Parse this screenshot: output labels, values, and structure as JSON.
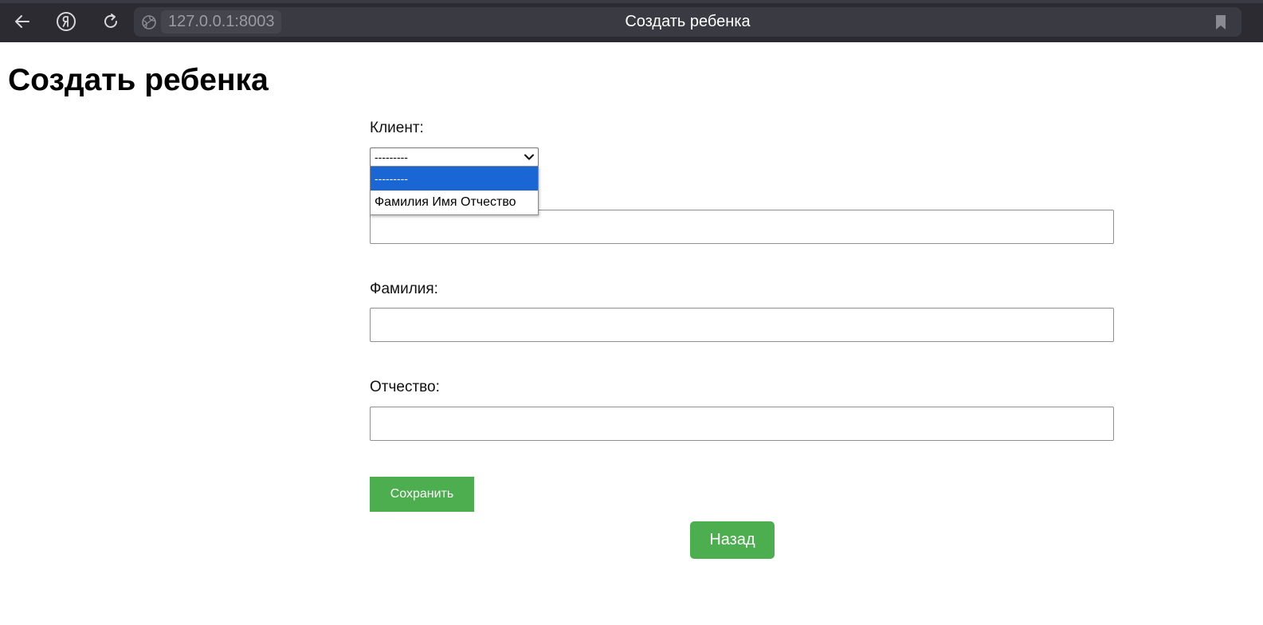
{
  "browser": {
    "url": "127.0.0.1:8003",
    "tab_title": "Создать ребенка"
  },
  "page": {
    "title": "Создать ребенка"
  },
  "form": {
    "client_label": "Клиент:",
    "client_select": {
      "selected": "---------",
      "options": [
        "---------",
        "Фамилия Имя Отчество"
      ]
    },
    "first_name_value": "",
    "last_name_label": "Фамилия:",
    "last_name_value": "",
    "patronymic_label": "Отчество:",
    "patronymic_value": "",
    "save_label": "Сохранить"
  },
  "back_label": "Назад",
  "colors": {
    "button_green": "#4cae4f",
    "option_highlight": "#1a66d4",
    "browser_chrome": "#2b2b31"
  }
}
